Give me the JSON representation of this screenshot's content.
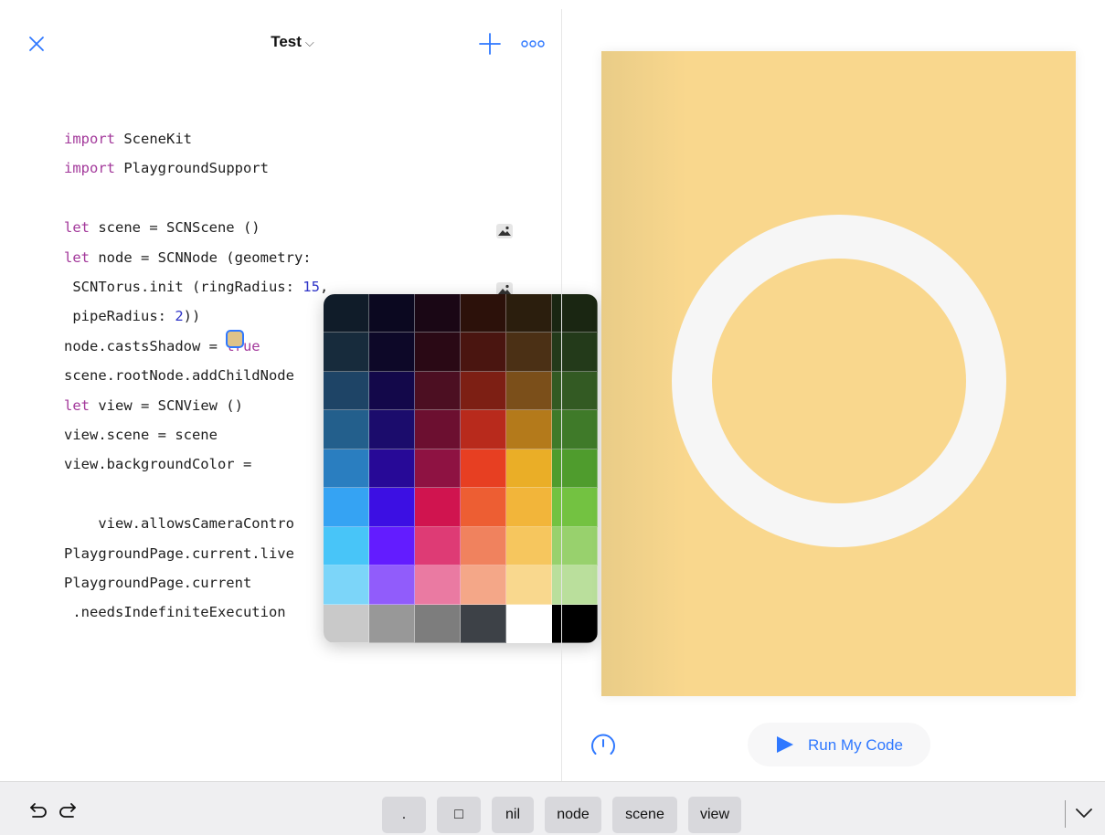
{
  "header": {
    "title": "Test",
    "close_icon": "close-icon",
    "title_chevron_icon": "chevron-down-icon",
    "add_icon": "plus-icon",
    "more_icon": "more-icon"
  },
  "code": {
    "lines": [
      [
        {
          "t": "import",
          "k": "kw"
        },
        {
          "t": " SceneKit"
        }
      ],
      [
        {
          "t": "import",
          "k": "kw"
        },
        {
          "t": " PlaygroundSupport"
        }
      ],
      [],
      [
        {
          "t": "let",
          "k": "kw"
        },
        {
          "t": " scene = SCNScene ()"
        }
      ],
      [
        {
          "t": "let",
          "k": "kw"
        },
        {
          "t": " node = SCNNode (geometry:"
        }
      ],
      [
        {
          "t": " SCNTorus.init (ringRadius: "
        },
        {
          "t": "15",
          "k": "num"
        },
        {
          "t": ","
        }
      ],
      [
        {
          "t": " pipeRadius: "
        },
        {
          "t": "2",
          "k": "num"
        },
        {
          "t": "))"
        }
      ],
      [
        {
          "t": "node.castsShadow = "
        },
        {
          "t": "true",
          "k": "kw"
        }
      ],
      [
        {
          "t": "scene.rootNode.addChildNode"
        }
      ],
      [
        {
          "t": "let",
          "k": "kw"
        },
        {
          "t": " view = SCNView ()"
        }
      ],
      [
        {
          "t": "view.scene = scene"
        }
      ],
      [
        {
          "t": "view.backgroundColor = "
        }
      ],
      [],
      [
        {
          "t": "    view.allowsCameraContro"
        }
      ],
      [
        {
          "t": "PlaygroundPage.current.live"
        }
      ],
      [
        {
          "t": "PlaygroundPage.current"
        }
      ],
      [
        {
          "t": " .needsIndefiniteExecution"
        }
      ]
    ],
    "background_color_value": "#dec389",
    "image_literal_icon": "image-icon"
  },
  "color_picker": {
    "colors": [
      [
        "#101c29",
        "#0b0820",
        "#1a0715",
        "#2c110a",
        "#2b1e0d",
        "#1a2612"
      ],
      [
        "#172b3c",
        "#0d0828",
        "#2a0915",
        "#4a1510",
        "#4b3015",
        "#233a1a"
      ],
      [
        "#1e4466",
        "#13084a",
        "#4c0f22",
        "#7d1f14",
        "#7b4f1a",
        "#335a23"
      ],
      [
        "#235f8c",
        "#1b0c6c",
        "#6c0f30",
        "#b82a1c",
        "#b47a1b",
        "#3f7a29"
      ],
      [
        "#2a7ec0",
        "#270997",
        "#8e1242",
        "#e73f22",
        "#eaae27",
        "#4f9c2d"
      ],
      [
        "#35a3f3",
        "#3c0fe3",
        "#d0144f",
        "#ed5e33",
        "#f2b53a",
        "#73c241"
      ],
      [
        "#48c5f8",
        "#631cff",
        "#de3b75",
        "#f0825e",
        "#f6c65e",
        "#98d16d"
      ],
      [
        "#7cd5f9",
        "#915cfb",
        "#ea7aa2",
        "#f4a788",
        "#f9d88e",
        "#badf9c"
      ],
      [
        "#c9c9c9",
        "#989898",
        "#7d7d7d",
        "#3d4147",
        "#ffffff",
        "#000000"
      ]
    ]
  },
  "live_view": {
    "background_color": "#f9d78d",
    "torus_color": "#f6f6f6"
  },
  "controls": {
    "timer_icon": "timer-icon",
    "run_label": "Run My Code",
    "run_icon": "play-icon",
    "accent": "#2f78ff"
  },
  "shortcut_bar": {
    "undo_icon": "undo-icon",
    "redo_icon": "redo-icon",
    "keys": [
      ".",
      "□",
      "nil",
      "node",
      "scene",
      "view"
    ],
    "collapse_icon": "chevron-down-icon"
  }
}
